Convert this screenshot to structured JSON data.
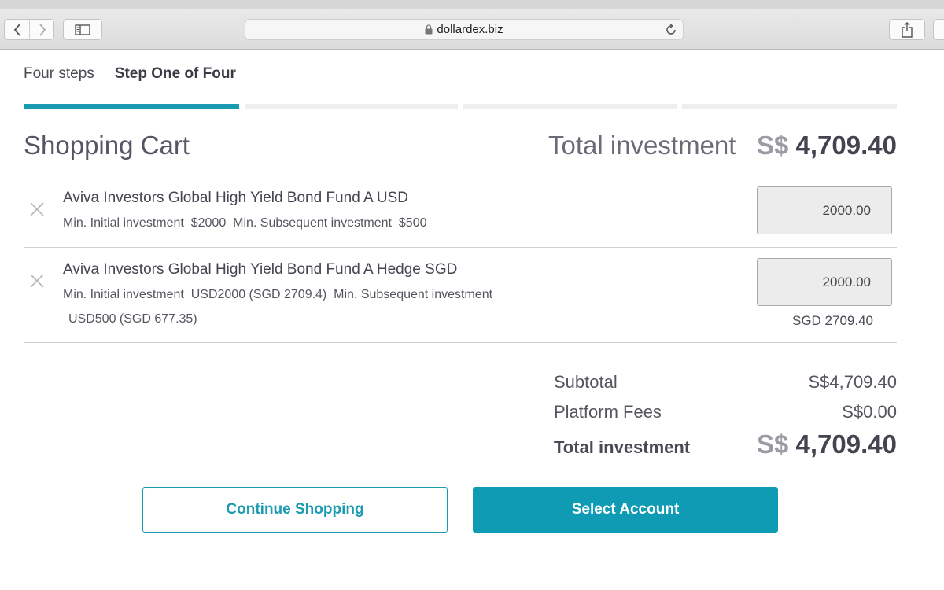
{
  "browser": {
    "url": "dollardex.biz"
  },
  "steps": {
    "label": "Four steps",
    "current": "Step One of Four",
    "total": 4,
    "completed": 1
  },
  "cart": {
    "title": "Shopping Cart",
    "total_label": "Total investment",
    "currency_symbol": "S$",
    "total_amount": "4,709.40"
  },
  "items": [
    {
      "name": "Aviva Investors Global High Yield Bond Fund A USD",
      "meta_line1": "Min. Initial investment  $2000  Min. Subsequent investment  $500",
      "meta_line2": "",
      "amount": "2000.00",
      "converted": ""
    },
    {
      "name": "Aviva Investors Global High Yield Bond Fund A Hedge SGD",
      "meta_line1": "Min. Initial investment  USD2000 (SGD 2709.4)  Min. Subsequent investment",
      "meta_line2": "USD500 (SGD 677.35)",
      "amount": "2000.00",
      "converted": "SGD 2709.40"
    }
  ],
  "summary": {
    "subtotal_label": "Subtotal",
    "subtotal_value": "S$4,709.40",
    "fees_label": "Platform Fees",
    "fees_value": "S$0.00",
    "total_label": "Total investment",
    "total_currency": "S$",
    "total_amount": "4,709.40"
  },
  "actions": {
    "continue_label": "Continue Shopping",
    "select_label": "Select Account"
  },
  "colors": {
    "accent": "#1a9bb1",
    "primary_button": "#0f9bb3"
  },
  "icons": [
    "back-arrow-icon",
    "forward-arrow-icon",
    "sidebar-icon",
    "lock-icon",
    "reload-icon",
    "share-icon",
    "close-icon"
  ]
}
